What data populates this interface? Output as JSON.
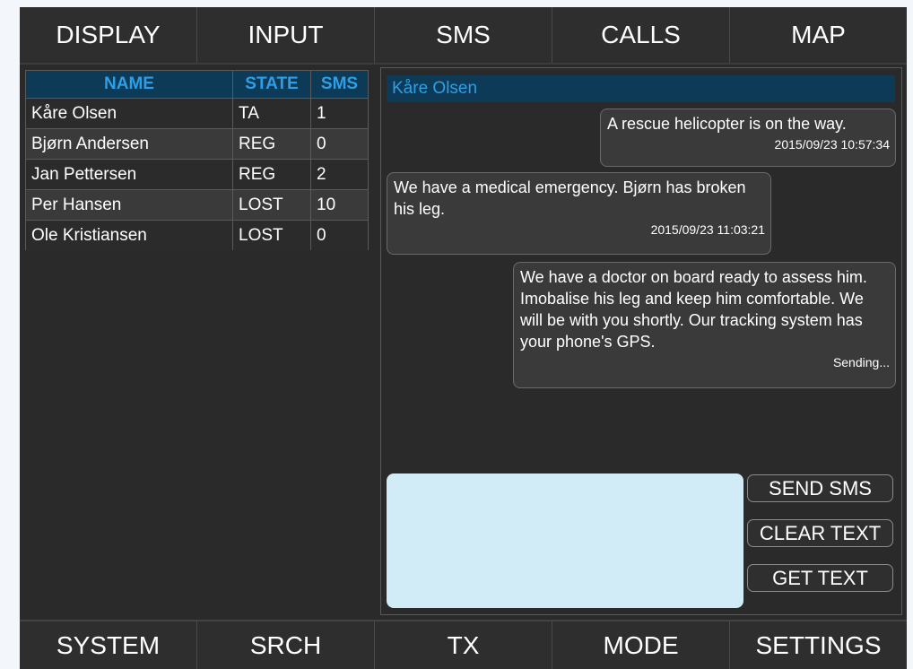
{
  "nav_top": [
    "DISPLAY",
    "INPUT",
    "SMS",
    "CALLS",
    "MAP"
  ],
  "nav_bottom": [
    "SYSTEM",
    "SRCH",
    "TX",
    "MODE",
    "SETTINGS"
  ],
  "contacts": {
    "headers": {
      "name": "NAME",
      "state": "STATE",
      "sms": "SMS"
    },
    "rows": [
      {
        "name": "Kåre Olsen",
        "state": "TA",
        "sms": "1"
      },
      {
        "name": "Bjørn Andersen",
        "state": "REG",
        "sms": "0"
      },
      {
        "name": "Jan Pettersen",
        "state": "REG",
        "sms": "2"
      },
      {
        "name": "Per Hansen",
        "state": "LOST",
        "sms": "10"
      },
      {
        "name": "Ole Kristiansen",
        "state": "LOST",
        "sms": "0"
      }
    ]
  },
  "conversation": {
    "contact": "Kåre Olsen",
    "messages": [
      {
        "direction": "outgoing",
        "text": "A rescue helicopter is on the way.",
        "time": "2015/09/23 10:57:34"
      },
      {
        "direction": "incoming",
        "text": "We have a medical emergency. Bjørn has broken his leg.",
        "time": "2015/09/23 11:03:21"
      },
      {
        "direction": "outgoing",
        "text": "We have a doctor on board ready to assess him. Imobalise his leg and keep him comfortable. We will be with you shortly. Our tracking system has your phone's GPS.",
        "time": "Sending..."
      }
    ]
  },
  "compose": {
    "value": ""
  },
  "actions": {
    "send": "SEND SMS",
    "clear": "CLEAR TEXT",
    "get": "GET TEXT"
  },
  "colors": {
    "background": "#2a2a2a",
    "header_bg": "#0d3a57",
    "accent": "#2e9fe6",
    "input_bg": "#d2ecf7"
  }
}
